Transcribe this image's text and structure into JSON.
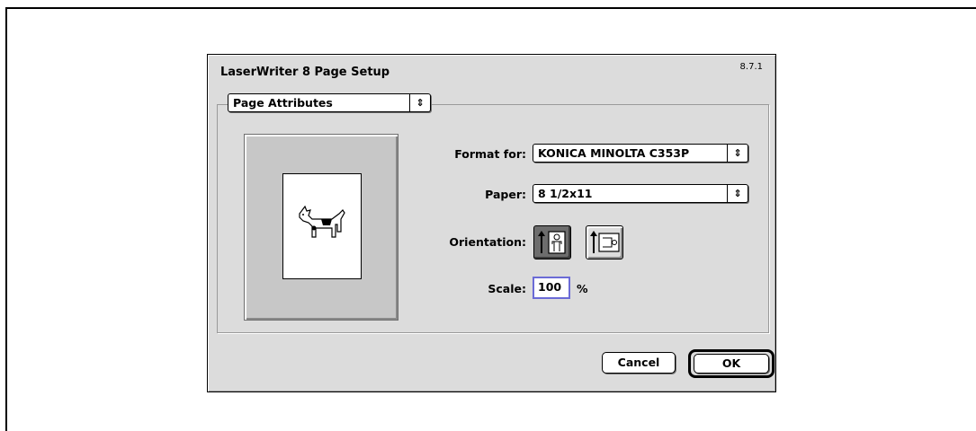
{
  "dialog": {
    "title": "LaserWriter 8 Page Setup",
    "version": "8.7.1",
    "section_popup": "Page Attributes",
    "format_for": {
      "label": "Format for:",
      "value": "KONICA MINOLTA C353P"
    },
    "paper": {
      "label": "Paper:",
      "value": "8 1/2x11"
    },
    "orientation": {
      "label": "Orientation:",
      "options": [
        "portrait-icon",
        "landscape-icon"
      ],
      "selected": "portrait-icon"
    },
    "scale": {
      "label": "Scale:",
      "value": "100",
      "unit": "%"
    },
    "buttons": {
      "cancel": "Cancel",
      "ok": "OK"
    },
    "popup_arrow": "⇕"
  },
  "colors": {
    "dialog_bg": "#dcdcdc",
    "focus_ring": "#6b6bd6",
    "selected_toggle": "#6d6d6d"
  }
}
